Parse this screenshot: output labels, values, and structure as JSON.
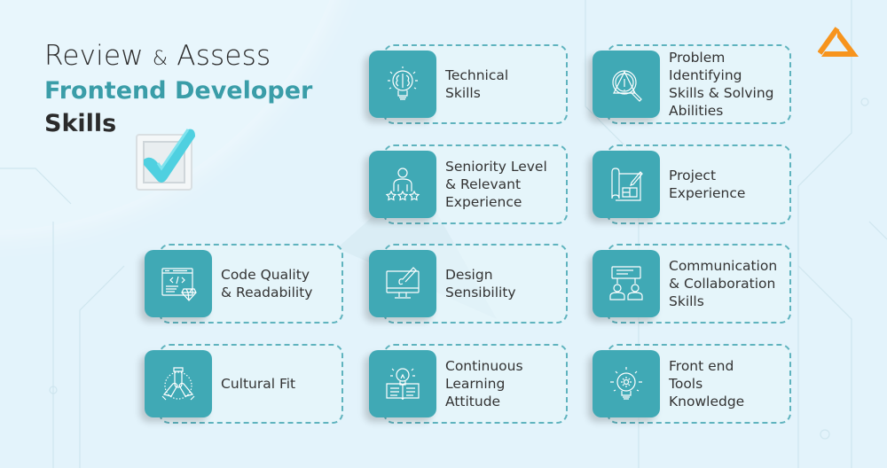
{
  "header": {
    "line1_part1": "Review",
    "line1_amp": "&",
    "line1_part2": "Assess",
    "line2": "Frontend Developer",
    "line3": "Skills"
  },
  "colors": {
    "accent": "#40a9b5",
    "title_accent": "#3a9da8",
    "logo": "#f7941d",
    "background": "#e3f3fb",
    "text": "#333333"
  },
  "logo": {
    "icon": "triangle-logo-icon"
  },
  "decor": {
    "icon": "checkbox-checked-icon"
  },
  "skills": [
    {
      "label": "Technical\nSkills",
      "icon": "brain-lightbulb-icon"
    },
    {
      "label": "Problem\nIdentifying\nSkills & Solving\nAbilities",
      "icon": "warning-magnifier-icon"
    },
    {
      "label": "Seniority Level\n& Relevant\nExperience",
      "icon": "person-stars-icon"
    },
    {
      "label": "Project\nExperience",
      "icon": "blueprint-pencil-icon"
    },
    {
      "label": "Code Quality\n& Readability",
      "icon": "code-window-diamond-icon"
    },
    {
      "label": "Design\nSensibility",
      "icon": "monitor-brush-icon"
    },
    {
      "label": "Communication\n& Collaboration\nSkills",
      "icon": "people-chat-icon"
    },
    {
      "label": "Cultural Fit",
      "icon": "hands-together-icon"
    },
    {
      "label": "Continuous\nLearning\nAttitude",
      "icon": "book-lightbulb-icon"
    },
    {
      "label": "Front end\nTools\nKnowledge",
      "icon": "gear-lightbulb-icon"
    }
  ]
}
